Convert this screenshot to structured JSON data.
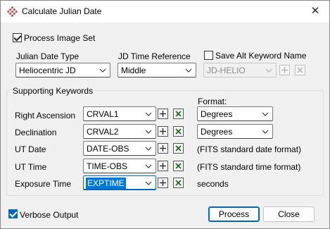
{
  "window": {
    "title": "Calculate Julian Date",
    "close_glyph": "✕"
  },
  "process_image_set": {
    "label": "Process Image Set",
    "checked": true
  },
  "julian_date_type": {
    "label": "Julian Date Type",
    "value": "Heliocentric JD"
  },
  "jd_time_reference": {
    "label": "JD Time Reference",
    "value": "Middle"
  },
  "alt_keyword": {
    "label": "Save Alt Keyword Name",
    "checked": false,
    "value": "JD-HELIO"
  },
  "supporting_keywords": {
    "title": "Supporting Keywords",
    "format_header": "Format:",
    "rows": [
      {
        "label": "Right Ascension",
        "keyword": "CRVAL1",
        "format": "Degrees"
      },
      {
        "label": "Declination",
        "keyword": "CRVAL2",
        "format": "Degrees"
      },
      {
        "label": "UT Date",
        "keyword": "DATE-OBS",
        "format_note": "(FITS standard date format)"
      },
      {
        "label": "UT Time",
        "keyword": "TIME-OBS",
        "format_note": "(FITS standard time format)"
      },
      {
        "label": "Exposure Time",
        "keyword": "EXPTIME",
        "format_note": "seconds"
      }
    ]
  },
  "verbose_output": {
    "label": "Verbose Output",
    "checked": true
  },
  "buttons": {
    "process": "Process",
    "close": "Close"
  },
  "colors": {
    "accent": "#0067c0",
    "dialog_bg": "#f0f0f0",
    "icon_red": "#d62828"
  }
}
